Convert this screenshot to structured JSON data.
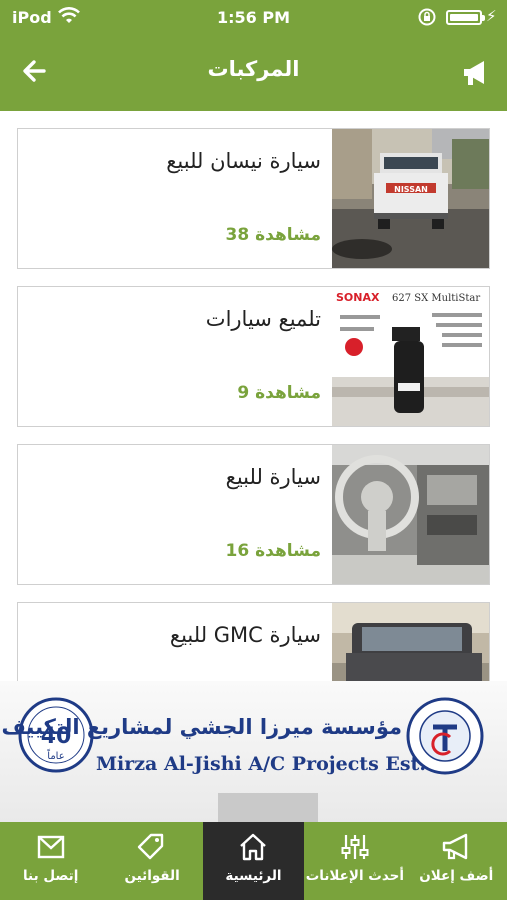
{
  "status_bar": {
    "carrier": "iPod",
    "time": "1:56 PM"
  },
  "navbar": {
    "title": "المركبات"
  },
  "listings": [
    {
      "title": "سيارة نيسان للبيع",
      "views": "مشاهدة 38",
      "image": "white nissan pickup truck"
    },
    {
      "title": "تلميع سيارات",
      "views": "مشاهدة 9",
      "image": "sonax 627 sx multistar car cleaner ad"
    },
    {
      "title": "سيارة للبيع",
      "views": "مشاهدة 16",
      "image": "car interior dashboard and steering wheel"
    },
    {
      "title": "سيارة GMC للبيع",
      "views": "",
      "image": "gmc suv"
    }
  ],
  "banner": {
    "arabic_text": "مؤسسة ميرزا الجشي لمشاريع التكييف",
    "english_text": "Mirza Al-Jishi A/C  Projects Est.",
    "badge_number": "40",
    "badge_unit": "عاماً"
  },
  "tab_bar": {
    "tabs": [
      {
        "label": "إتصل بنا",
        "icon": "mail-icon"
      },
      {
        "label": "القوائين",
        "icon": "tag-icon"
      },
      {
        "label": "الرئيسية",
        "icon": "home-icon"
      },
      {
        "label": "أحدث الإعلانات",
        "icon": "sliders-icon"
      },
      {
        "label": "أضف إعلان",
        "icon": "megaphone-icon"
      }
    ],
    "active_index": 2
  },
  "colors": {
    "primary": "#7aa33c",
    "active_tab": "#2b2b2b",
    "views_text": "#7aa33c"
  }
}
